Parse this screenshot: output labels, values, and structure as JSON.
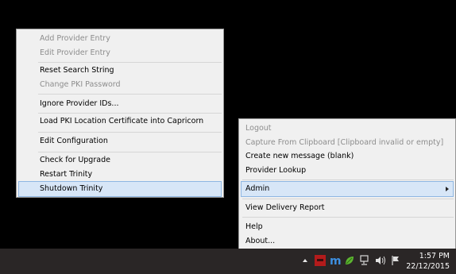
{
  "left_menu": {
    "items": [
      {
        "label": "Add Provider Entry",
        "enabled": false
      },
      {
        "label": "Edit Provider Entry",
        "enabled": false
      },
      {
        "label": "Reset Search String",
        "enabled": true
      },
      {
        "label": "Change PKI Password",
        "enabled": false
      },
      {
        "label": "Ignore Provider IDs...",
        "enabled": true
      },
      {
        "label": "Load PKI Location Certificate into Capricorn",
        "enabled": true
      },
      {
        "label": "Edit Configuration",
        "enabled": true
      },
      {
        "label": "Check for Upgrade",
        "enabled": true
      },
      {
        "label": "Restart Trinity",
        "enabled": true
      },
      {
        "label": "Shutdown Trinity",
        "enabled": true,
        "highlighted": true
      }
    ]
  },
  "right_menu": {
    "items": [
      {
        "label": "Logout",
        "enabled": false
      },
      {
        "label": "Capture From Clipboard [Clipboard invalid or empty]",
        "enabled": false
      },
      {
        "label": "Create new message (blank)",
        "enabled": true
      },
      {
        "label": "Provider Lookup",
        "enabled": true
      },
      {
        "label": "Admin",
        "enabled": true,
        "highlighted": true,
        "has_submenu": true
      },
      {
        "label": "View Delivery Report",
        "enabled": true
      },
      {
        "label": "Help",
        "enabled": true
      },
      {
        "label": "About...",
        "enabled": true
      }
    ]
  },
  "taskbar": {
    "time": "1:57 PM",
    "date": "22/12/2015",
    "tray_icons": [
      "show-hidden-icons-icon",
      "red-app-icon",
      "m-app-icon",
      "green-leaf-icon",
      "network-icon",
      "volume-icon",
      "action-center-flag-icon"
    ]
  },
  "colors": {
    "menu_background": "#f0f0f0",
    "highlight_background": "#d7e6f7",
    "highlight_border": "#8fb7e3",
    "disabled_text": "#8d8d8d",
    "taskbar": "#2a2626"
  }
}
